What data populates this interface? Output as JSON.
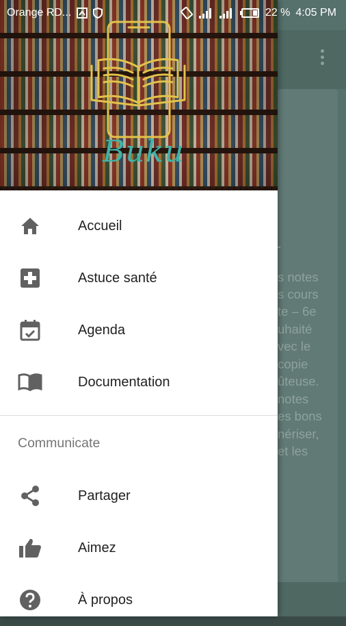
{
  "status_bar": {
    "carrier": "Orange RD...",
    "battery": "22 %",
    "time": "4:05 PM",
    "icons": [
      "screenshot-icon",
      "shield-icon",
      "rotate-icon",
      "signal-icon",
      "signal-icon",
      "battery-icon"
    ]
  },
  "header": {
    "logo_text": "Buku"
  },
  "menu": {
    "primary": [
      {
        "label": "Accueil",
        "icon": "home-icon"
      },
      {
        "label": "Astuce santé",
        "icon": "medical-plus-icon"
      },
      {
        "label": "Agenda",
        "icon": "calendar-check-icon"
      },
      {
        "label": "Documentation",
        "icon": "book-icon"
      }
    ],
    "section_title": "Communicate",
    "secondary": [
      {
        "label": "Partager",
        "icon": "share-icon"
      },
      {
        "label": "Aimez",
        "icon": "thumb-up-icon"
      },
      {
        "label": "À propos",
        "icon": "help-icon"
      }
    ]
  },
  "background_text": {
    "lines": [
      "s notes",
      "s cours",
      "te – 6e",
      "uhaité",
      "vec le",
      "copie",
      "ûteuse.",
      "notes",
      "es bons",
      "nériser,",
      "et les"
    ]
  },
  "colors": {
    "accent": "#3fb3a8",
    "drawer_bg": "#ffffff",
    "scrim_app": "#56706b"
  }
}
